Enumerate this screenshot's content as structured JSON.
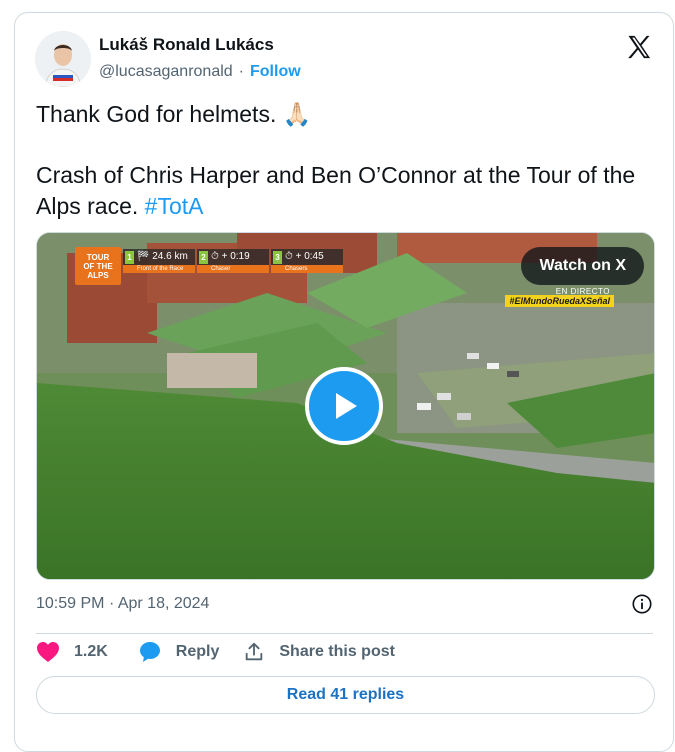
{
  "author": {
    "name": "Lukáš Ronald Lukács",
    "handle": "@lucasaganronald",
    "separator": "·",
    "follow_label": "Follow"
  },
  "post": {
    "line1": "Thank God for helmets. 🙏🏻",
    "line2_text": "Crash of Chris Harper and Ben O’Connor at the Tour of the Alps race. ",
    "hashtag": "#TotA"
  },
  "video": {
    "watch_label": "Watch on X",
    "broadcast": {
      "logo_line1": "TOUR",
      "logo_line2": "OF THE",
      "logo_line3": "ALPS",
      "group1_num": "1",
      "group1_value": "🏁 24.6 km",
      "group1_sub": "Front of the Race",
      "group2_num": "2",
      "group2_value": "⏱ + 0:19",
      "group2_sub": "Chaser",
      "group3_num": "3",
      "group3_value": "⏱ + 0:45",
      "group3_sub": "Chasers",
      "live_label": "EN DIRECTO",
      "hashtag_banner": "#ElMundoRuedaXSeñal"
    }
  },
  "meta": {
    "time": "10:59 PM",
    "separator": "·",
    "date": "Apr 18, 2024"
  },
  "actions": {
    "like_count": "1.2K",
    "reply_label": "Reply",
    "share_label": "Share this post"
  },
  "read_replies_label": "Read 41 replies",
  "colors": {
    "accent": "#1d9bf0",
    "like": "#f91880",
    "text": "#0f1419",
    "muted": "#536471",
    "border": "#cfd9de"
  },
  "icons": {
    "brand": "x-logo-icon",
    "play": "play-icon",
    "info": "info-icon",
    "like": "heart-icon",
    "reply": "reply-bubble-icon",
    "share": "share-upload-icon"
  }
}
